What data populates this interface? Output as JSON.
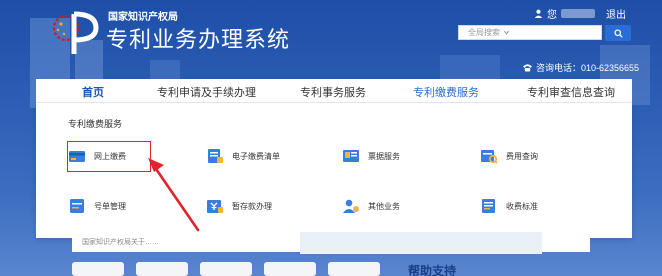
{
  "header": {
    "org_name": "国家知识产权局",
    "system_title": "专利业务办理系统",
    "user_greeting": "您",
    "logout": "退出",
    "search_placeholder": "全局搜索",
    "hotline": "咨询电话：010-62356655"
  },
  "nav": {
    "home": "首页",
    "items": [
      "专利申请及手续办理",
      "专利事务服务",
      "专利缴费服务",
      "专利审查信息查询"
    ],
    "active": "专利缴费服务"
  },
  "panel": {
    "title": "专利缴费服务",
    "services": [
      {
        "label": "网上缴费",
        "icon": "card-icon",
        "highlighted": true
      },
      {
        "label": "电子缴费清单",
        "icon": "document-list-icon"
      },
      {
        "label": "票据服务",
        "icon": "receipt-icon"
      },
      {
        "label": "费用查询",
        "icon": "fee-query-icon"
      },
      {
        "label": "号单管理",
        "icon": "number-list-icon"
      },
      {
        "label": "暂存款办理",
        "icon": "deposit-icon"
      },
      {
        "label": "其他业务",
        "icon": "other-services-icon"
      },
      {
        "label": "收费标准",
        "icon": "fee-standard-icon"
      }
    ]
  },
  "below": {
    "partial_text": "国家知识产权局关于……",
    "bottom_title": "帮助支持"
  },
  "colors": {
    "accent": "#2b6dd6",
    "highlight": "#e0242c",
    "header_bg": "#1d4fa8"
  }
}
